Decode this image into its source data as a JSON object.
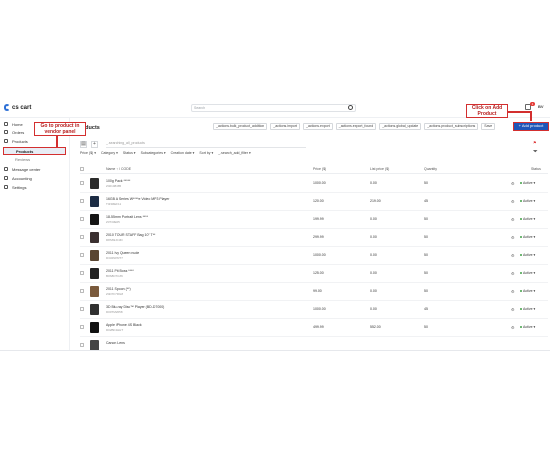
{
  "topbar": {
    "logo": "cs cart",
    "search_placeholder": "Search",
    "notification_count": "1",
    "avatar_initials": "BV"
  },
  "sidebar": {
    "items": [
      {
        "label": "Home"
      },
      {
        "label": "Orders"
      },
      {
        "label": "Products"
      },
      {
        "label": "Message center"
      },
      {
        "label": "Accounting"
      },
      {
        "label": "Settings"
      }
    ],
    "sub_items": [
      {
        "label": "Products"
      },
      {
        "label": "Reviews"
      }
    ]
  },
  "main": {
    "title": "Products",
    "actions": [
      "_actions.bulk_product_addition",
      "_actions.import",
      "_actions.export",
      "_actions.export_found",
      "_actions.global_update",
      "_actions.product_subscriptions",
      "Save"
    ],
    "add_button": "+ Add product",
    "search_placeholder": "_.searching_all_products",
    "filters": [
      "Price ($) ▾",
      "Category ▾",
      "Status ▾",
      "Subcategories ▾",
      "Creation date ▾",
      "Sort by ▾",
      "_.search_add_filter ▾"
    ],
    "columns": {
      "name": "Name ↑ / CODE",
      "price": "Price ($)",
      "list_price": "List price ($)",
      "quantity": "Quantity",
      "status": "Status"
    },
    "rows": [
      {
        "name": "100g Pack *****",
        "code": "Z40108485",
        "price": "1000.00",
        "list_price": "0.00",
        "qty": "50",
        "status": "Active ▾",
        "thumb": "#2b2b2b"
      },
      {
        "name": "16GB A Series W****e Video MP3 Player",
        "code": "T4NMEF11",
        "price": "120.00",
        "list_price": "219.00",
        "qty": "45",
        "status": "Active ▾",
        "thumb": "#1c2c44"
      },
      {
        "name": "18-55mm Portrait Lens ****",
        "code": "Z3733E05",
        "price": "199.99",
        "list_price": "0.00",
        "qty": "50",
        "status": "Active ▾",
        "thumb": "#151515"
      },
      {
        "name": "2010 TOUR STAFF Bag 10\" T**",
        "code": "D8S69JC3D",
        "price": "299.99",
        "list_price": "0.00",
        "qty": "50",
        "status": "Active ▾",
        "thumb": "#3b3030"
      },
      {
        "name": "2011 Ivy Queen nude",
        "code": "D332NPRT7",
        "price": "1000.00",
        "list_price": "0.00",
        "qty": "50",
        "status": "Active ▾",
        "thumb": "#5a4632"
      },
      {
        "name": "2011 Pit Boss ****",
        "code": "B0S8D7CZ6",
        "price": "125.00",
        "list_price": "0.00",
        "qty": "50",
        "status": "Active ▾",
        "thumb": "#222222"
      },
      {
        "name": "2011 Spoon (**)",
        "code": "Z4D7F7RG8",
        "price": "99.00",
        "list_price": "0.00",
        "qty": "50",
        "status": "Active ▾",
        "thumb": "#7a5a3c"
      },
      {
        "name": "3D Blu-ray Disc™ Player (BD-D7000)",
        "code": "D00TM2058",
        "price": "1000.00",
        "list_price": "0.00",
        "qty": "45",
        "status": "Active ▾",
        "thumb": "#303030"
      },
      {
        "name": "Apple iPhone 4S Black",
        "code": "D02BF4HHT",
        "price": "499.99",
        "list_price": "552.00",
        "qty": "50",
        "status": "Active ▾",
        "thumb": "#111111"
      },
      {
        "name": "Canon Lens",
        "code": "",
        "price": "",
        "list_price": "",
        "qty": "",
        "status": "",
        "thumb": "#444444"
      }
    ]
  },
  "annotations": {
    "left": "Go to product in vendor panel",
    "right": "Click on Add Product",
    "color": "#d32f2f"
  }
}
